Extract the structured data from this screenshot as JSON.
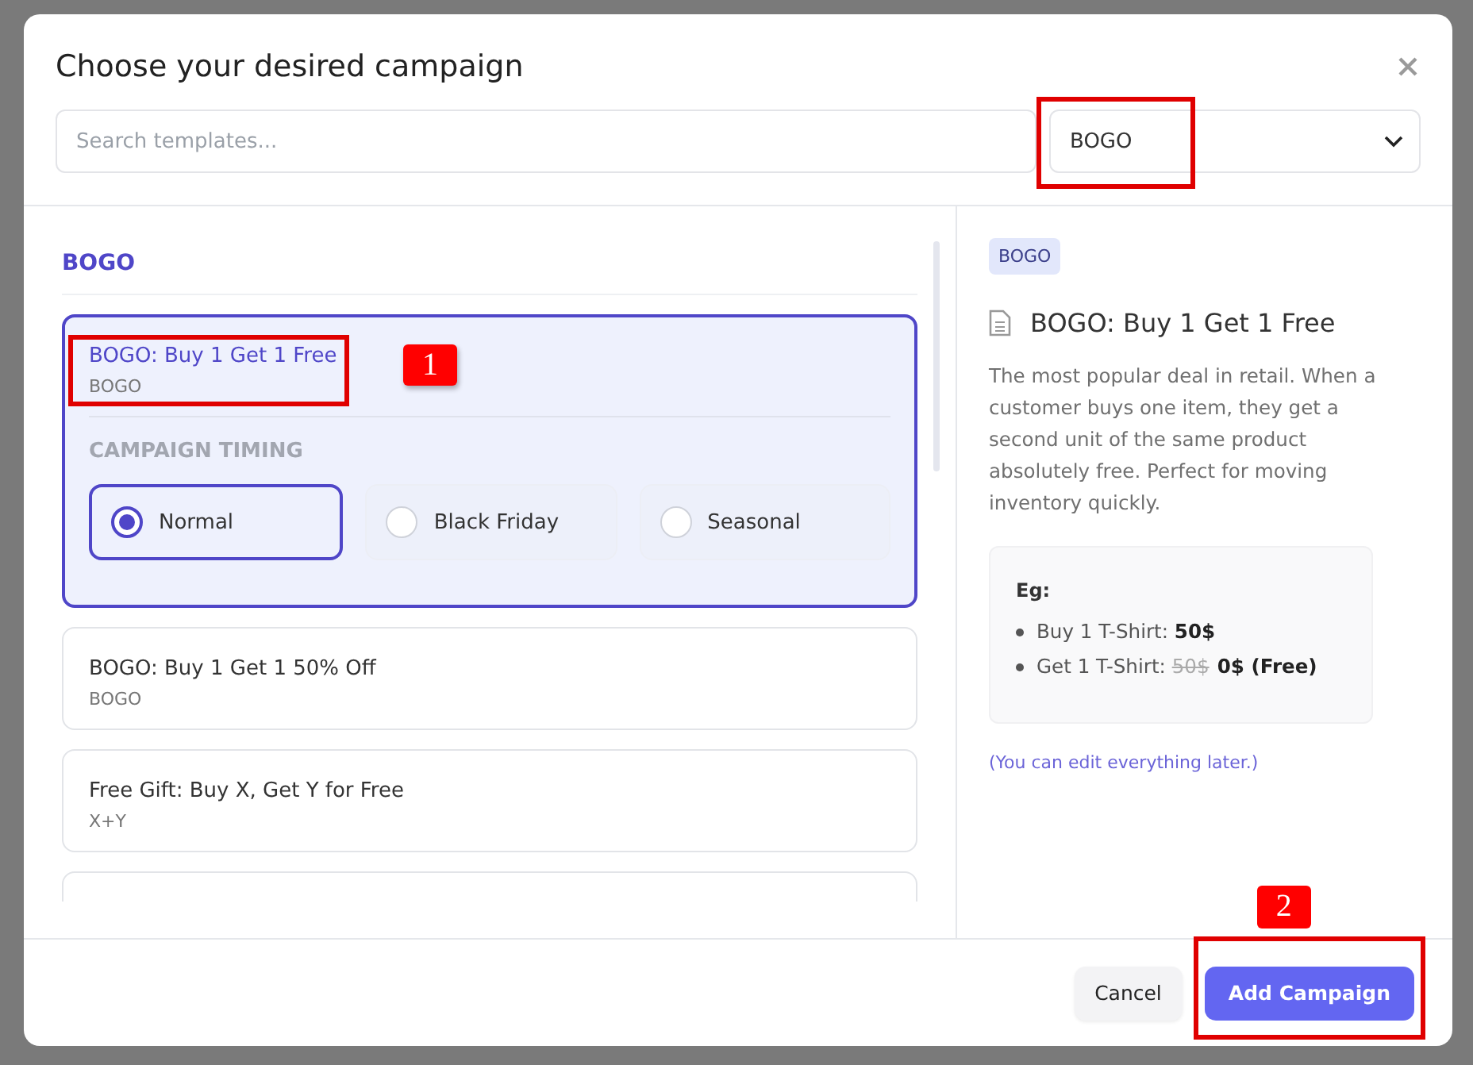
{
  "dialog": {
    "title": "Choose your desired campaign"
  },
  "search": {
    "placeholder": "Search templates..."
  },
  "category_select": {
    "value": "BOGO",
    "highlighted": true
  },
  "section_title": "BOGO",
  "timing_label": "CAMPAIGN TIMING",
  "templates": [
    {
      "kind": "card",
      "title": "BOGO: Buy 1 Get 1 Free",
      "tag": "BOGO",
      "selected": true,
      "callout": "1"
    },
    {
      "kind": "card",
      "title": "BOGO: Buy 1 Get 1 50% Off",
      "tag": "BOGO",
      "selected": false
    },
    {
      "kind": "card",
      "title": "Free Gift: Buy X, Get Y for Free",
      "tag": "X+Y",
      "selected": false
    },
    {
      "kind": "clipped"
    }
  ],
  "timing_options": [
    {
      "label": "Normal",
      "selected": true
    },
    {
      "label": "Black Friday",
      "selected": false
    },
    {
      "label": "Seasonal",
      "selected": false
    }
  ],
  "detail": {
    "badge": "BOGO",
    "title": "BOGO: Buy 1 Get 1 Free",
    "description": "The most popular deal in retail. When a customer buys one item, they get a second unit of the same product absolutely free. Perfect for moving inventory quickly.",
    "example_label": "Eg:",
    "example_lines": [
      "Buy 1 T-Shirt: **50$**",
      "Get 1 T-Shirt: "
    ],
    "old_price": "50$",
    "new_price": "0$ (Free)",
    "note": "(You can edit everything later.)"
  },
  "footer": {
    "cancel": "Cancel",
    "submit": "Add Campaign",
    "submit_callout": "2"
  }
}
